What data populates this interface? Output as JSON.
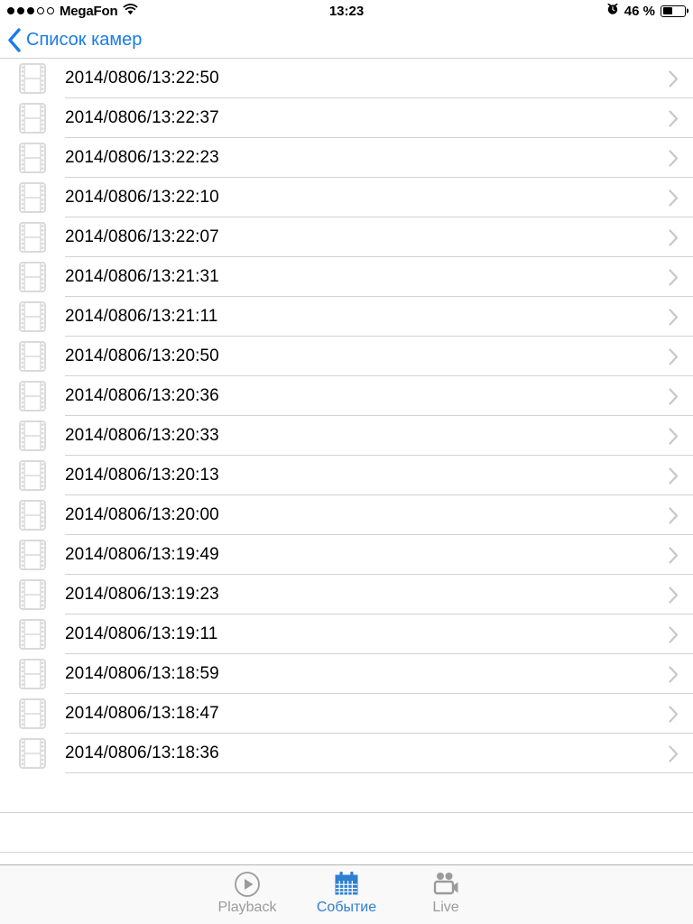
{
  "status_bar": {
    "carrier": "MegaFon",
    "signal_dots_total": 5,
    "signal_dots_filled": 3,
    "wifi_icon": "wifi-icon",
    "time": "13:23",
    "alarm_icon": "alarm-clock-icon",
    "battery_percent_label": "46 %",
    "battery_level": 46,
    "battery_icon": "battery-icon"
  },
  "nav_bar": {
    "back_icon": "chevron-left-icon",
    "back_label": "Список камер"
  },
  "list": {
    "row_icon": "film-strip-icon",
    "row_accessory_icon": "chevron-right-icon",
    "empty_rows": 2,
    "rows": [
      {
        "timestamp": "2014/0806/13:22:50"
      },
      {
        "timestamp": "2014/0806/13:22:37"
      },
      {
        "timestamp": "2014/0806/13:22:23"
      },
      {
        "timestamp": "2014/0806/13:22:10"
      },
      {
        "timestamp": "2014/0806/13:22:07"
      },
      {
        "timestamp": "2014/0806/13:21:31"
      },
      {
        "timestamp": "2014/0806/13:21:11"
      },
      {
        "timestamp": "2014/0806/13:20:50"
      },
      {
        "timestamp": "2014/0806/13:20:36"
      },
      {
        "timestamp": "2014/0806/13:20:33"
      },
      {
        "timestamp": "2014/0806/13:20:13"
      },
      {
        "timestamp": "2014/0806/13:20:00"
      },
      {
        "timestamp": "2014/0806/13:19:49"
      },
      {
        "timestamp": "2014/0806/13:19:23"
      },
      {
        "timestamp": "2014/0806/13:19:11"
      },
      {
        "timestamp": "2014/0806/13:18:59"
      },
      {
        "timestamp": "2014/0806/13:18:47"
      },
      {
        "timestamp": "2014/0806/13:18:36"
      }
    ]
  },
  "tab_bar": {
    "tabs": [
      {
        "label": "Playback",
        "icon": "play-circle-icon",
        "active": false
      },
      {
        "label": "Событие",
        "icon": "calendar-icon",
        "active": true
      },
      {
        "label": "Live",
        "icon": "video-camera-icon",
        "active": false
      }
    ]
  },
  "colors": {
    "accent_blue": "#1a7ce8",
    "tab_active_blue": "#2f7fd1",
    "tab_inactive_gray": "#9b9b9b",
    "separator": "#d2d2d4",
    "icon_gray": "#d8d8d8",
    "tab_bar_bg": "#f9f9f9"
  }
}
